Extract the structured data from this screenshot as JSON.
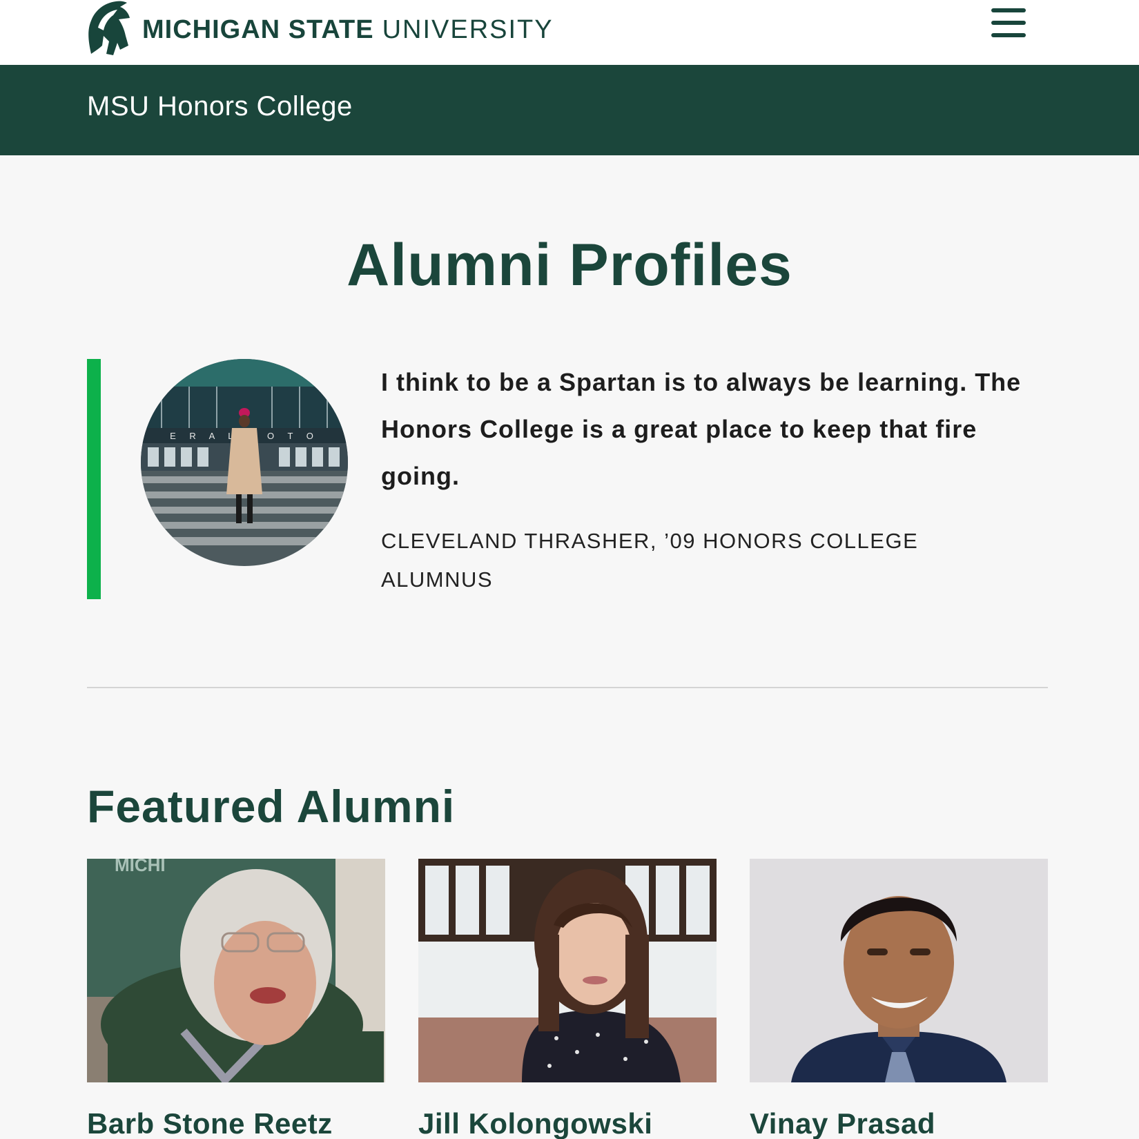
{
  "header": {
    "wordmark_bold": "MICHIGAN STATE",
    "wordmark_light": "UNIVERSITY",
    "logo_icon": "spartan-helmet-icon",
    "menu_icon": "hamburger-menu-icon"
  },
  "unit": {
    "name": "MSU Honors College"
  },
  "page": {
    "title": "Alumni Profiles"
  },
  "quote": {
    "text": "I think to be a Spartan is to always be learning. The Honors College is a great place to keep that fire going.",
    "attribution": "Cleveland Thrasher, ’09 Honors College Alumnus",
    "photo_sign_text": "E R A L M O T O"
  },
  "featured": {
    "title": "Featured Alumni",
    "alumni": [
      {
        "name": "Barb Stone Reetz",
        "photo_text": "MICHI"
      },
      {
        "name": "Jill Kolongowski"
      },
      {
        "name": "Vinay Prasad"
      }
    ]
  },
  "colors": {
    "brand_green": "#18453b",
    "accent_green": "#0db14b",
    "background": "#f7f7f7"
  }
}
